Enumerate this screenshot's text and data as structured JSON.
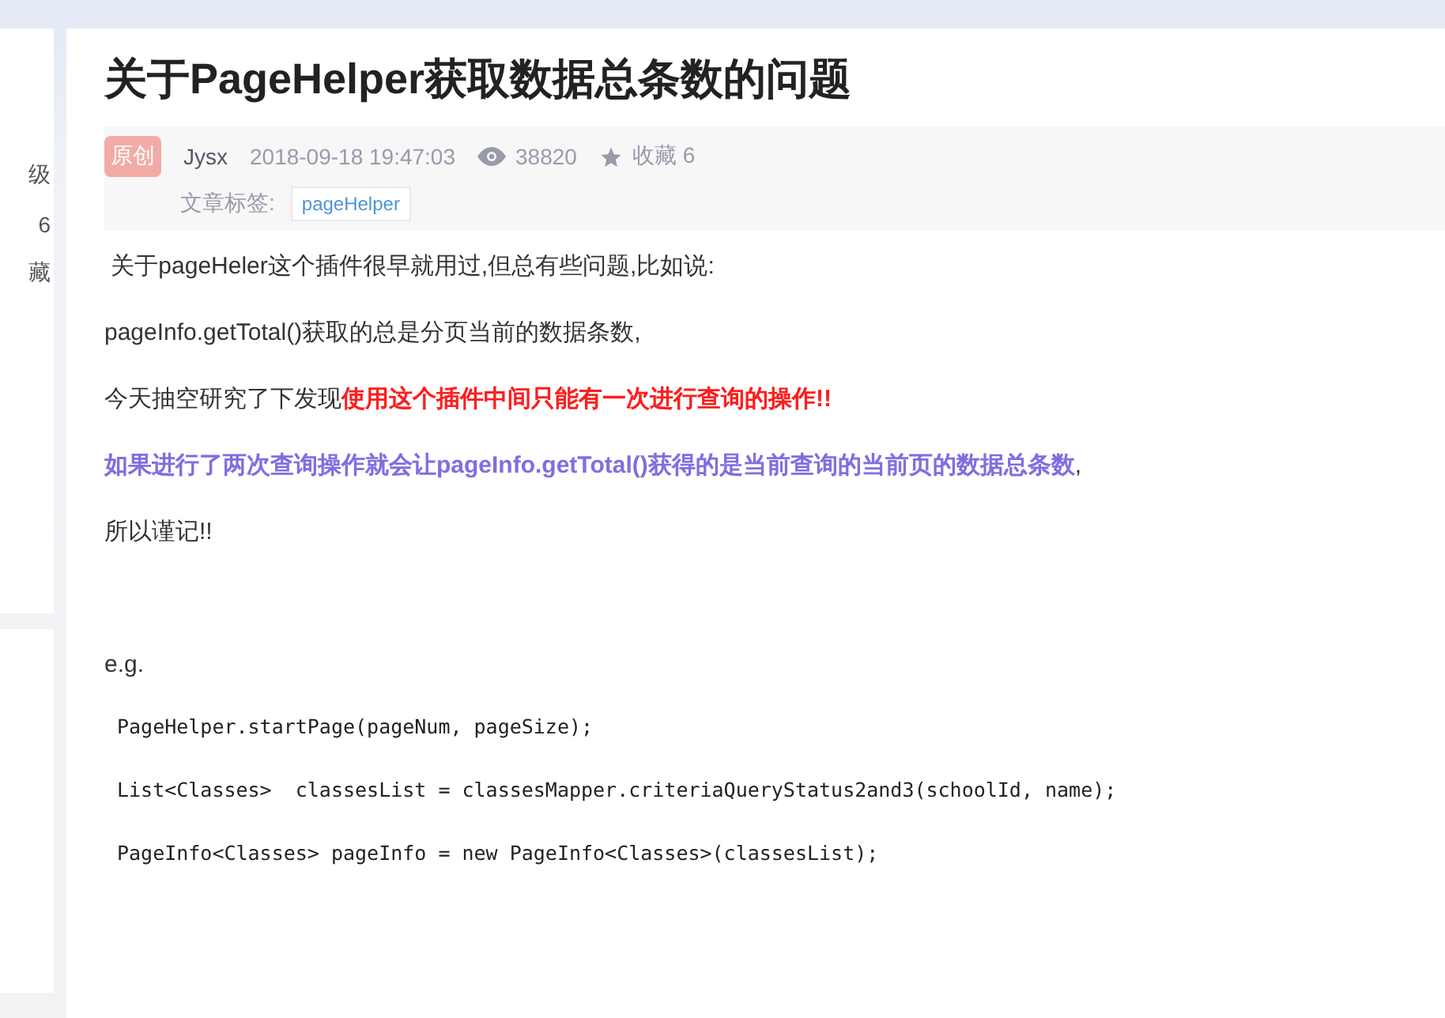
{
  "sidebar": {
    "profile_texts": [
      "级",
      "6",
      "藏"
    ]
  },
  "article": {
    "title": "关于PageHelper获取数据总条数的问题",
    "meta": {
      "badge": "原创",
      "author": "Jysx",
      "date": "2018-09-18 19:47:03",
      "views": "38820",
      "favorites": "收藏 6",
      "tags_label": "文章标签:",
      "tags": [
        "pageHelper"
      ]
    },
    "paragraphs": [
      {
        "kind": "plain",
        "text": " 关于pageHeler这个插件很早就用过,但总有些问题,比如说:"
      },
      {
        "kind": "plain",
        "text": "pageInfo.getTotal()获取的总是分页当前的数据条数,"
      },
      {
        "kind": "plain",
        "text": "今天抽空研究了下发现**使用这个插件中间只能有一次进行查询的操作!!**"
      },
      {
        "kind": "emphasis",
        "text": "**如果进行了两次查询操作就会让pageInfo.getTotal()获得的是当前查询的当前页的数据总条数**,"
      },
      {
        "kind": "plain",
        "text": "所以谨记!!"
      },
      {
        "kind": "spacer"
      },
      {
        "kind": "plain",
        "text": "e.g."
      },
      {
        "kind": "code",
        "text": "PageHelper.startPage(pageNum, pageSize);"
      },
      {
        "kind": "code",
        "text": "List<Classes>  classesList = classesMapper.criteriaQueryStatus2and3(schoolId, name);"
      },
      {
        "kind": "code",
        "text": "PageInfo<Classes> pageInfo = new PageInfo<Classes>(classesList);"
      }
    ]
  }
}
